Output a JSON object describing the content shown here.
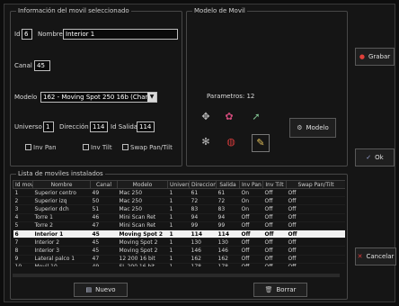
{
  "info_panel": {
    "title": "Información del movil seleccionado",
    "id_label": "Id",
    "id_value": "6",
    "name_label": "Nombre",
    "name_value": "Interior 1",
    "channel_label": "Canal",
    "channel_value": "45",
    "model_label": "Modelo",
    "model_value": "162 - Moving Spot 250 16b (Chang)",
    "universe_label": "Universo",
    "universe_value": "1",
    "address_label": "Dirección",
    "address_value": "114",
    "output_label": "Id Salida",
    "output_value": "114",
    "checks": [
      "Inv Pan",
      "Inv Tilt",
      "Swap Pan/Tilt"
    ]
  },
  "model_panel": {
    "title": "Modelo de Movil",
    "params_label": "Parametros: 12",
    "model_button_label": "Modelo"
  },
  "list_panel": {
    "title": "Lista de moviles instalados",
    "columns": [
      "Id movil",
      "Nombre",
      "Canal",
      "Modelo",
      "Universo",
      "Direccion",
      "Salida",
      "Inv Pan",
      "Inv Tilt",
      "Swap Pan/Tilt"
    ],
    "rows": [
      [
        "1",
        "Superior centro",
        "49",
        "Mac 250",
        "1",
        "61",
        "61",
        "On",
        "Off",
        "Off"
      ],
      [
        "2",
        "Superior izq",
        "50",
        "Mac 250",
        "1",
        "72",
        "72",
        "On",
        "Off",
        "Off"
      ],
      [
        "3",
        "Superior dch",
        "51",
        "Mac 250",
        "1",
        "83",
        "83",
        "On",
        "Off",
        "Off"
      ],
      [
        "4",
        "Torre 1",
        "46",
        "Mini Scan Ret",
        "1",
        "94",
        "94",
        "Off",
        "Off",
        "Off"
      ],
      [
        "5",
        "Torre 2",
        "47",
        "Mini Scan Ret",
        "1",
        "99",
        "99",
        "Off",
        "Off",
        "Off"
      ],
      [
        "6",
        "Interior 1",
        "45",
        "Moving Spot 2",
        "1",
        "114",
        "114",
        "Off",
        "Off",
        "Off"
      ],
      [
        "7",
        "Interior 2",
        "45",
        "Moving Spot 2",
        "1",
        "130",
        "130",
        "Off",
        "Off",
        "Off"
      ],
      [
        "8",
        "Interior 3",
        "45",
        "Moving Spot 2",
        "1",
        "146",
        "146",
        "Off",
        "Off",
        "Off"
      ],
      [
        "9",
        "Lateral palco 1",
        "47",
        "12 200 16 bit",
        "1",
        "162",
        "162",
        "Off",
        "Off",
        "Off"
      ],
      [
        "10",
        "Movil 10",
        "49",
        "SL 200 16 bit",
        "1",
        "178",
        "178",
        "Off",
        "Off",
        "Off"
      ]
    ],
    "selected_index": 5
  },
  "buttons": {
    "new": "Nuevo",
    "delete": "Borrar",
    "save": "Grabar",
    "ok": "Ok",
    "cancel": "Cancelar"
  },
  "colors": {
    "save_icon": "#e0403a",
    "ok_icon": "#9aa6d8",
    "cancel_icon": "#e03a3a"
  }
}
